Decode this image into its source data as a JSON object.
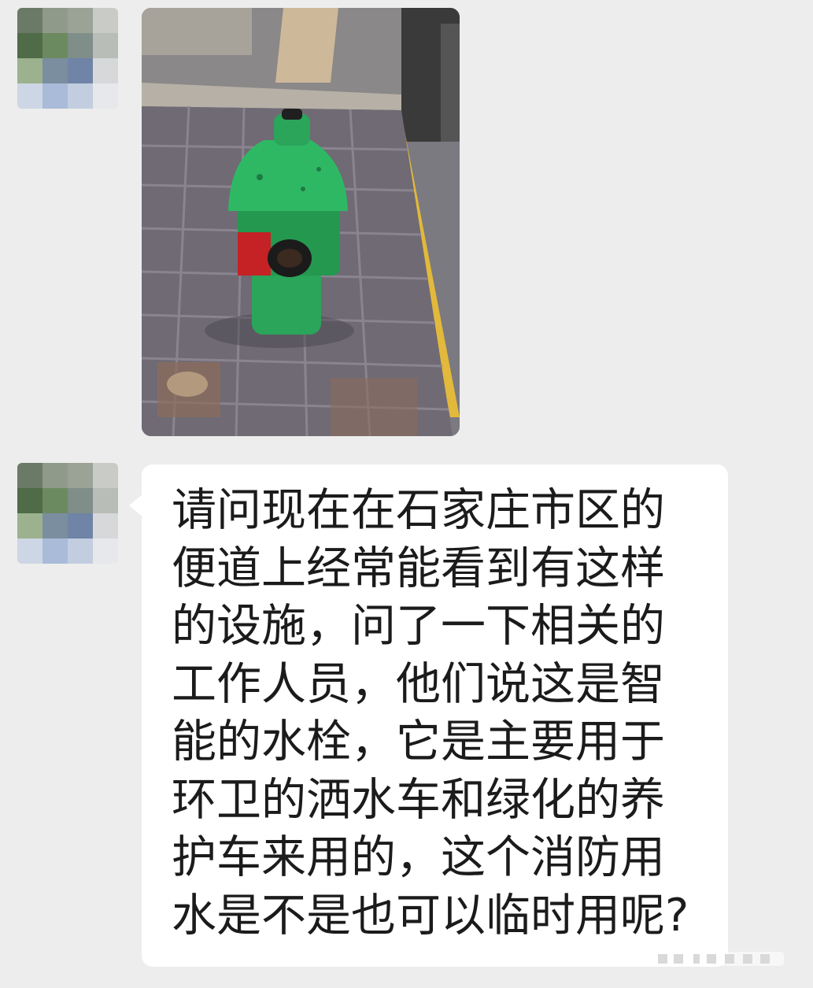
{
  "chat": {
    "messages": [
      {
        "sender": "contact",
        "type": "image",
        "image_subject": "green-fire-hydrant-on-brick-sidewalk"
      },
      {
        "sender": "contact",
        "type": "text",
        "text": "请问现在在石家庄市区的便道上经常能看到有这样的设施，问了一下相关的工作人员，他们说这是智能的水栓，它是主要用于环卫的洒水车和绿化的养护车来用的，这个消防用水是不是也可以临时用呢?"
      }
    ]
  },
  "colors": {
    "background": "#ededed",
    "bubble": "#ffffff",
    "text": "#1b1b1b",
    "hydrant": "#2aa55a"
  }
}
